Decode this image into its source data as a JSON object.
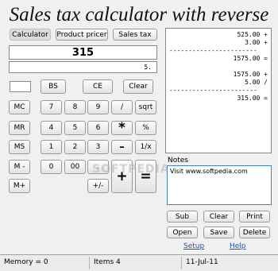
{
  "app": {
    "title": "Sales tax calculator with reverse"
  },
  "tabs": [
    {
      "label": "Calculator",
      "active": true
    },
    {
      "label": "Product pricer",
      "active": false
    },
    {
      "label": "Sales tax",
      "active": false
    }
  ],
  "display": {
    "main": "315",
    "secondary": "5."
  },
  "keys": {
    "bs": "BS",
    "ce": "CE",
    "clear": "Clear",
    "mc": "MC",
    "mr": "MR",
    "ms": "MS",
    "mminus": "M -",
    "mplus": "M+",
    "n0": "0",
    "n00": "00",
    "n1": "1",
    "n2": "2",
    "n3": "3",
    "n4": "4",
    "n5": "5",
    "n6": "6",
    "n7": "7",
    "n8": "8",
    "n9": "9",
    "dot": ".",
    "divide": "/",
    "multiply": "*",
    "minus": "–",
    "plus": "+",
    "equals": "=",
    "sqrt": "sqrt",
    "percent": "%",
    "reciprocal": "1/x",
    "plusminus": "+/-"
  },
  "tape": {
    "lines": [
      "525.00 +",
      "3.00 +",
      "-----------------------",
      "1575.00 =",
      "",
      "1575.00 +",
      "5.00 /",
      "-----------------------",
      "315.00 ="
    ]
  },
  "notes": {
    "label": "Notes",
    "text": "Visit www.softpedia.com"
  },
  "tape_buttons": {
    "sub": "Sub",
    "clear": "Clear",
    "print": "Print",
    "open": "Open",
    "save": "Save",
    "delete": "Delete"
  },
  "links": {
    "setup": "Setup",
    "help": "Help"
  },
  "status": {
    "memory": "Memory = 0",
    "items": "Items 4",
    "date": "11-Jul-11"
  },
  "watermark": "SOFTPEDIA",
  "colors": {
    "link": "#1f4fb5",
    "notes_border": "#4a7fc0"
  }
}
